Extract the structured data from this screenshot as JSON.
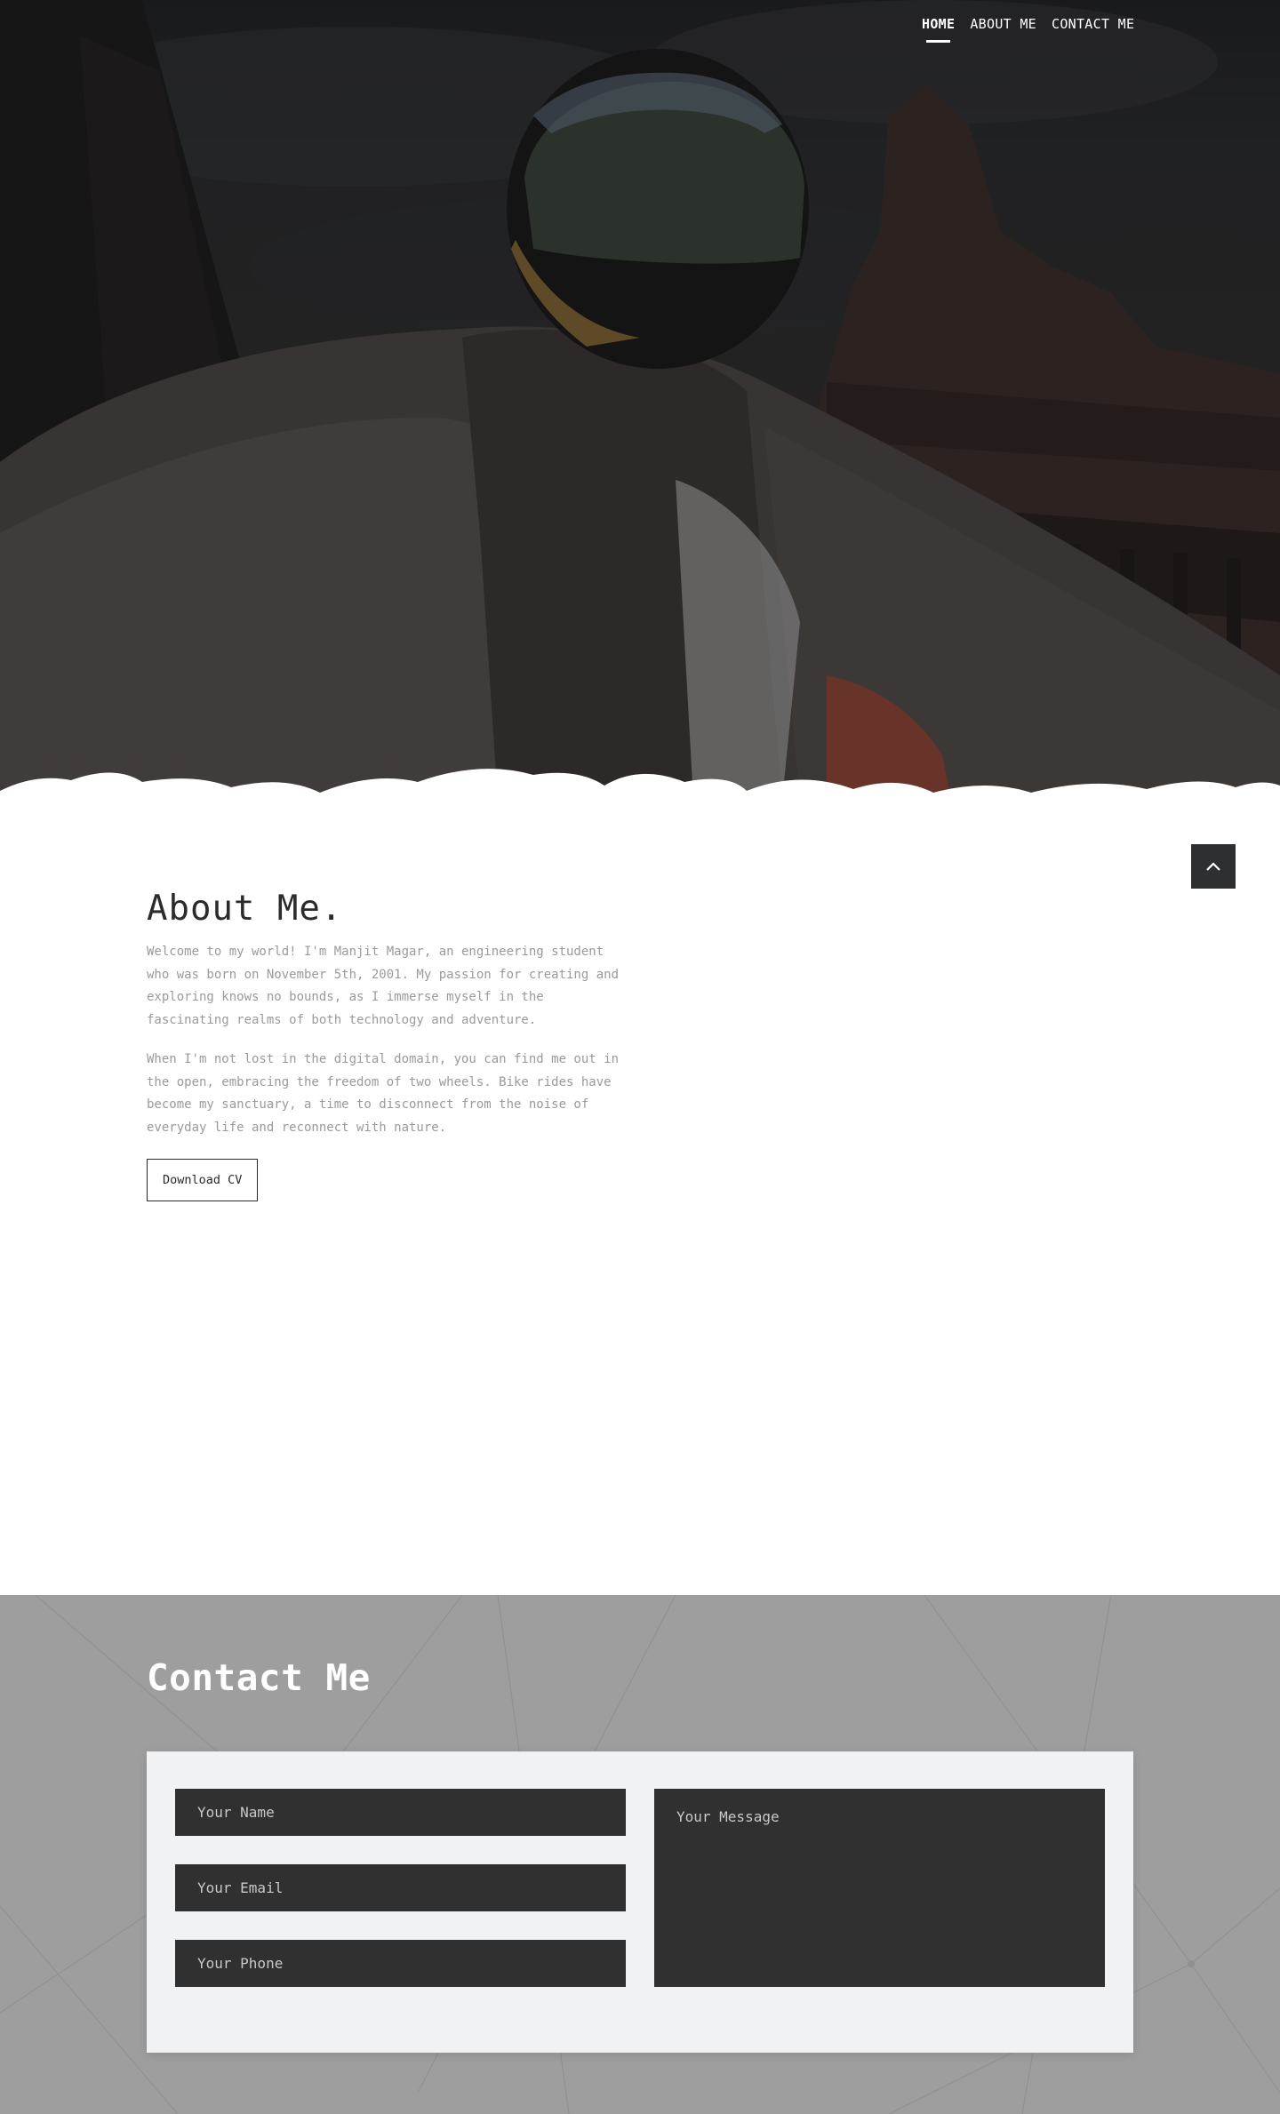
{
  "nav": {
    "items": [
      {
        "label": "HOME",
        "active": true
      },
      {
        "label": "ABOUT ME",
        "active": false
      },
      {
        "label": "CONTACT ME",
        "active": false
      }
    ]
  },
  "back_to_top": {
    "icon": "chevron-up-icon"
  },
  "about": {
    "heading": "About Me.",
    "paragraph_1": "Welcome to my world! I'm Manjit Magar, an engineering student who was born on November 5th, 2001. My passion for creating and exploring knows no bounds, as I immerse myself in the fascinating realms of both technology and adventure.",
    "paragraph_2": "When I'm not lost in the digital domain, you can find me out in the open, embracing the freedom of two wheels. Bike rides have become my sanctuary, a time to disconnect from the noise of everyday life and reconnect with nature.",
    "download_cv_label": "Download CV"
  },
  "contact": {
    "heading": "Contact Me",
    "name_placeholder": "Your Name",
    "email_placeholder": "Your Email",
    "phone_placeholder": "Your Phone",
    "message_placeholder": "Your Message"
  },
  "colors": {
    "hero_overlay": "#1f1f21",
    "contact_bg": "#9e9e9e",
    "form_card_bg": "#f1f2f4",
    "field_bg": "#303030",
    "back_to_top_bg": "#2e2f31"
  }
}
